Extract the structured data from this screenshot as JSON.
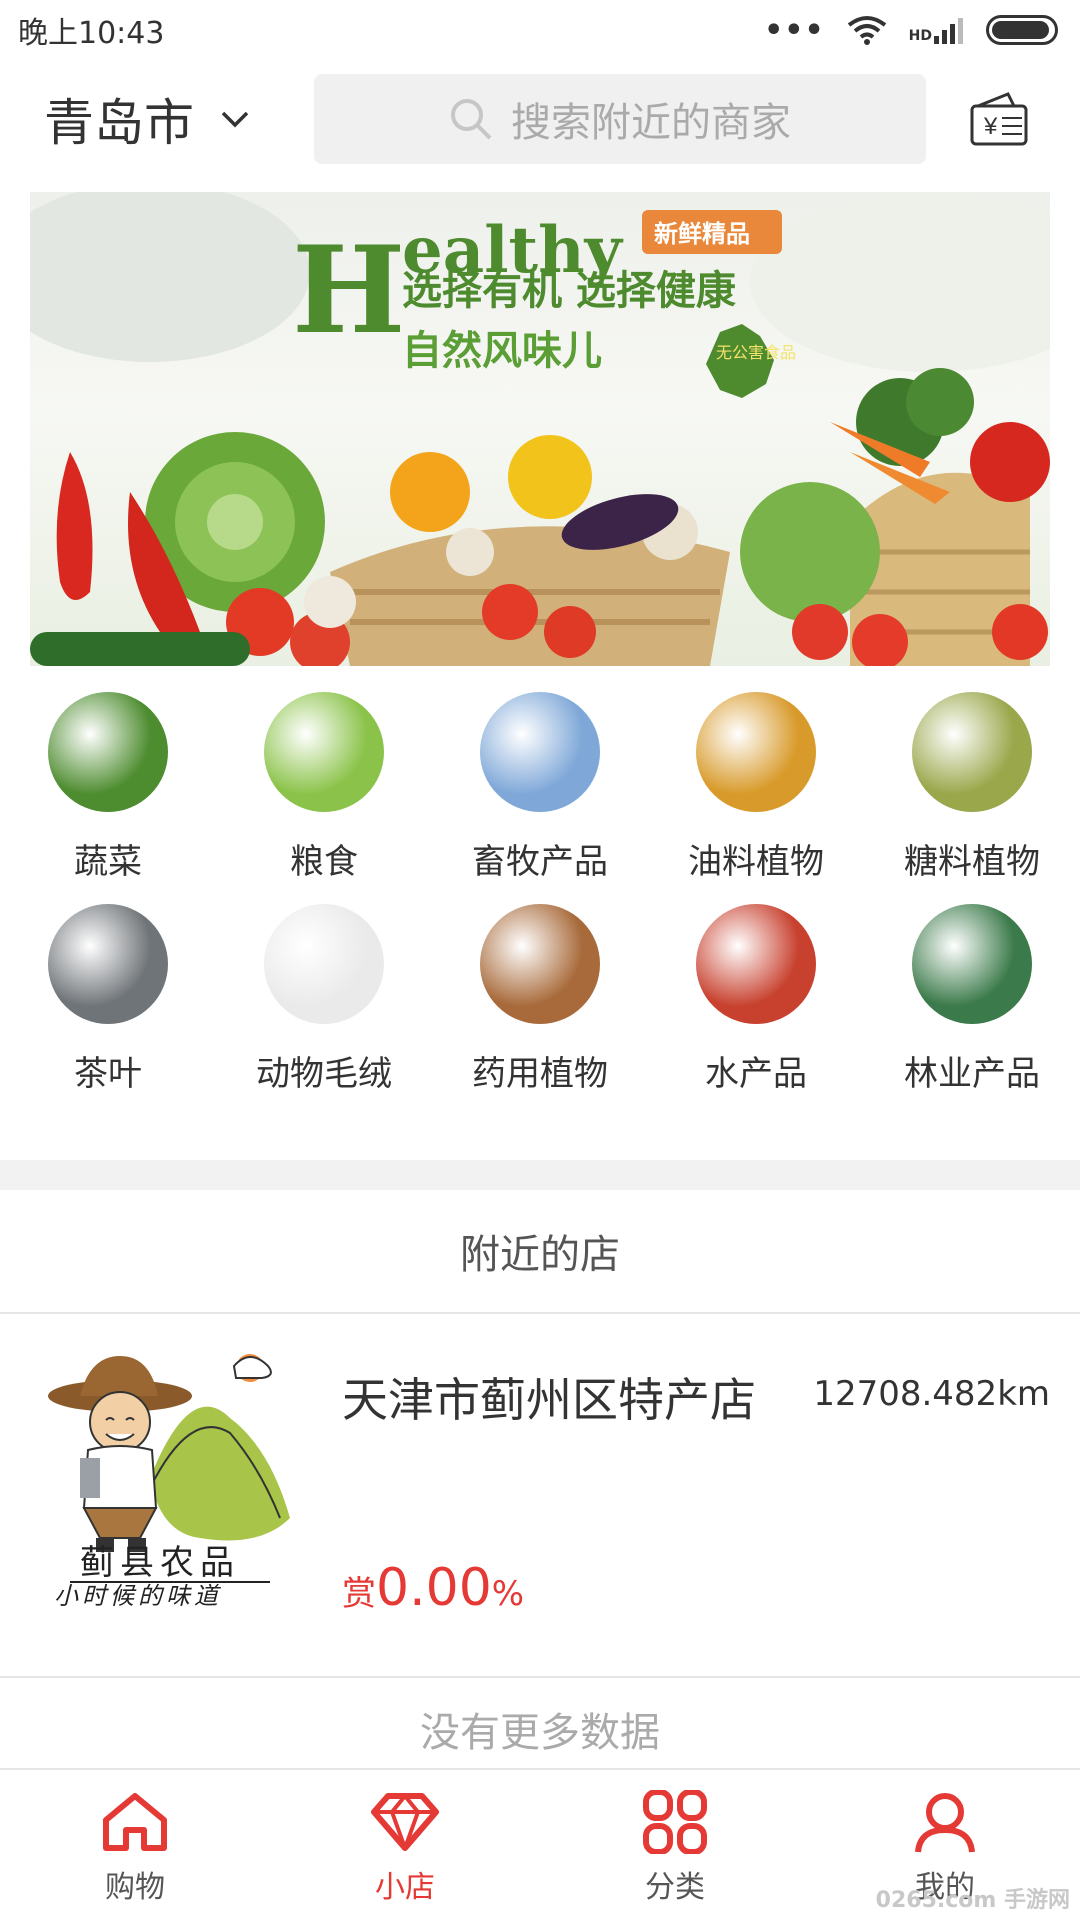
{
  "status_bar": {
    "time": "晚上10:43",
    "network": "HD",
    "battery_level": 0.95
  },
  "header": {
    "city": "青岛市",
    "search_placeholder": "搜索附近的商家"
  },
  "banner": {
    "headline": "Healthy",
    "tag": "新鲜精品",
    "line1": "选择有机 选择健康",
    "line2": "自然风味儿",
    "seal": "无公害食品"
  },
  "categories": [
    {
      "label": "蔬菜",
      "icon": "vegetables-icon",
      "color": "#4d8c2f"
    },
    {
      "label": "粮食",
      "icon": "grain-icon",
      "color": "#8bc34a"
    },
    {
      "label": "畜牧产品",
      "icon": "livestock-icon",
      "color": "#7fa8d8"
    },
    {
      "label": "油料植物",
      "icon": "oil-plant-icon",
      "color": "#d89a2a"
    },
    {
      "label": "糖料植物",
      "icon": "sugar-plant-icon",
      "color": "#9aa74a"
    },
    {
      "label": "茶叶",
      "icon": "tea-icon",
      "color": "#6f7478"
    },
    {
      "label": "动物毛绒",
      "icon": "wool-icon",
      "color": "#eaeaea"
    },
    {
      "label": "药用植物",
      "icon": "medicinal-plant-icon",
      "color": "#a86a3a"
    },
    {
      "label": "水产品",
      "icon": "seafood-icon",
      "color": "#c8412f"
    },
    {
      "label": "林业产品",
      "icon": "bamboo-icon",
      "color": "#3b7a4a"
    }
  ],
  "nearby": {
    "title": "附近的店",
    "shops": [
      {
        "name": "天津市蓟州区特产店",
        "distance": "12708.482km",
        "reward_prefix": "赏",
        "reward_value": "0.00",
        "reward_suffix": "%",
        "logo_title": "蓟县农品",
        "logo_slogan": "小时候的味道"
      }
    ],
    "no_more": "没有更多数据"
  },
  "tabs": [
    {
      "label": "购物",
      "icon": "home-icon"
    },
    {
      "label": "小店",
      "icon": "diamond-icon",
      "active": true
    },
    {
      "label": "分类",
      "icon": "grid-icon"
    },
    {
      "label": "我的",
      "icon": "user-icon"
    }
  ],
  "watermark": "0265.com 手游网",
  "colors": {
    "accent": "#e53935",
    "banner_green": "#4e8a2e",
    "banner_orange": "#e9873a"
  }
}
